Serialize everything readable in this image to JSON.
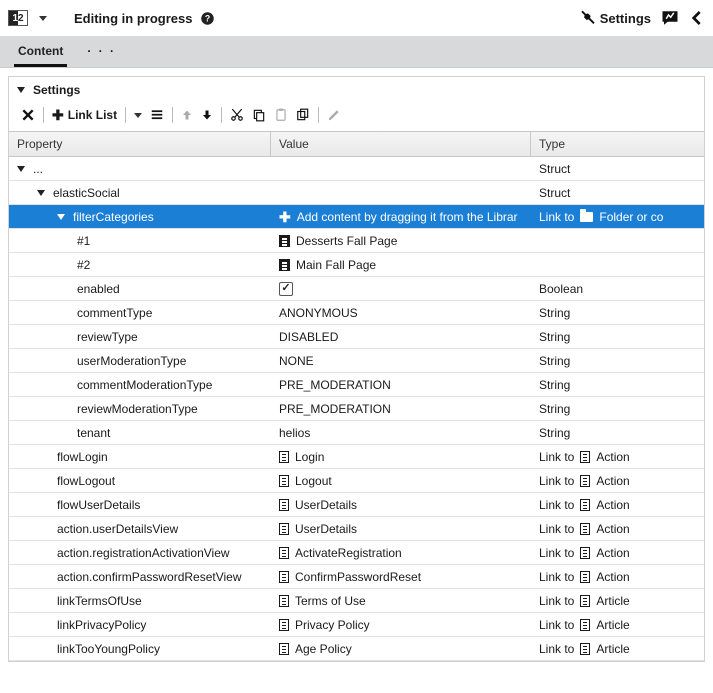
{
  "topbar": {
    "badge": {
      "d1": "1",
      "d2": "2"
    },
    "title": "Editing in progress",
    "settings_label": "Settings"
  },
  "tabs": {
    "content": "Content",
    "more": "· · ·"
  },
  "panel": {
    "title": "Settings"
  },
  "toolbar": {
    "link_list": "Link List"
  },
  "grid": {
    "headers": {
      "property": "Property",
      "value": "Value",
      "type": "Type"
    },
    "root_label": "...",
    "root_type": "Struct",
    "elastic_label": "elasticSocial",
    "elastic_type": "Struct",
    "filter": {
      "label": "filterCategories",
      "value_hint": "Add content by dragging it from the Librar",
      "type_prefix": "Link to",
      "type_suffix": "Folder or co",
      "items": [
        {
          "label": "#1",
          "value": "Desserts Fall Page"
        },
        {
          "label": "#2",
          "value": "Main Fall Page"
        }
      ]
    },
    "props": [
      {
        "label": "enabled",
        "value": "",
        "kind": "check",
        "type": "Boolean"
      },
      {
        "label": "commentType",
        "value": "ANONYMOUS",
        "kind": "text",
        "type": "String"
      },
      {
        "label": "reviewType",
        "value": "DISABLED",
        "kind": "text",
        "type": "String"
      },
      {
        "label": "userModerationType",
        "value": "NONE",
        "kind": "text",
        "type": "String"
      },
      {
        "label": "commentModerationType",
        "value": "PRE_MODERATION",
        "kind": "text",
        "type": "String"
      },
      {
        "label": "reviewModerationType",
        "value": "PRE_MODERATION",
        "kind": "text",
        "type": "String"
      },
      {
        "label": "tenant",
        "value": "helios",
        "kind": "text",
        "type": "String"
      }
    ],
    "links": [
      {
        "label": "flowLogin",
        "value": "Login",
        "type": "Action"
      },
      {
        "label": "flowLogout",
        "value": "Logout",
        "type": "Action"
      },
      {
        "label": "flowUserDetails",
        "value": "UserDetails",
        "type": "Action"
      },
      {
        "label": "action.userDetailsView",
        "value": "UserDetails",
        "type": "Action"
      },
      {
        "label": "action.registrationActivationView",
        "value": "ActivateRegistration",
        "type": "Action"
      },
      {
        "label": "action.confirmPasswordResetView",
        "value": "ConfirmPasswordReset",
        "type": "Action"
      },
      {
        "label": "linkTermsOfUse",
        "value": "Terms of Use",
        "type": "Article"
      },
      {
        "label": "linkPrivacyPolicy",
        "value": "Privacy Policy",
        "type": "Article"
      },
      {
        "label": "linkTooYoungPolicy",
        "value": "Age Policy",
        "type": "Article"
      }
    ],
    "link_to": "Link to"
  }
}
